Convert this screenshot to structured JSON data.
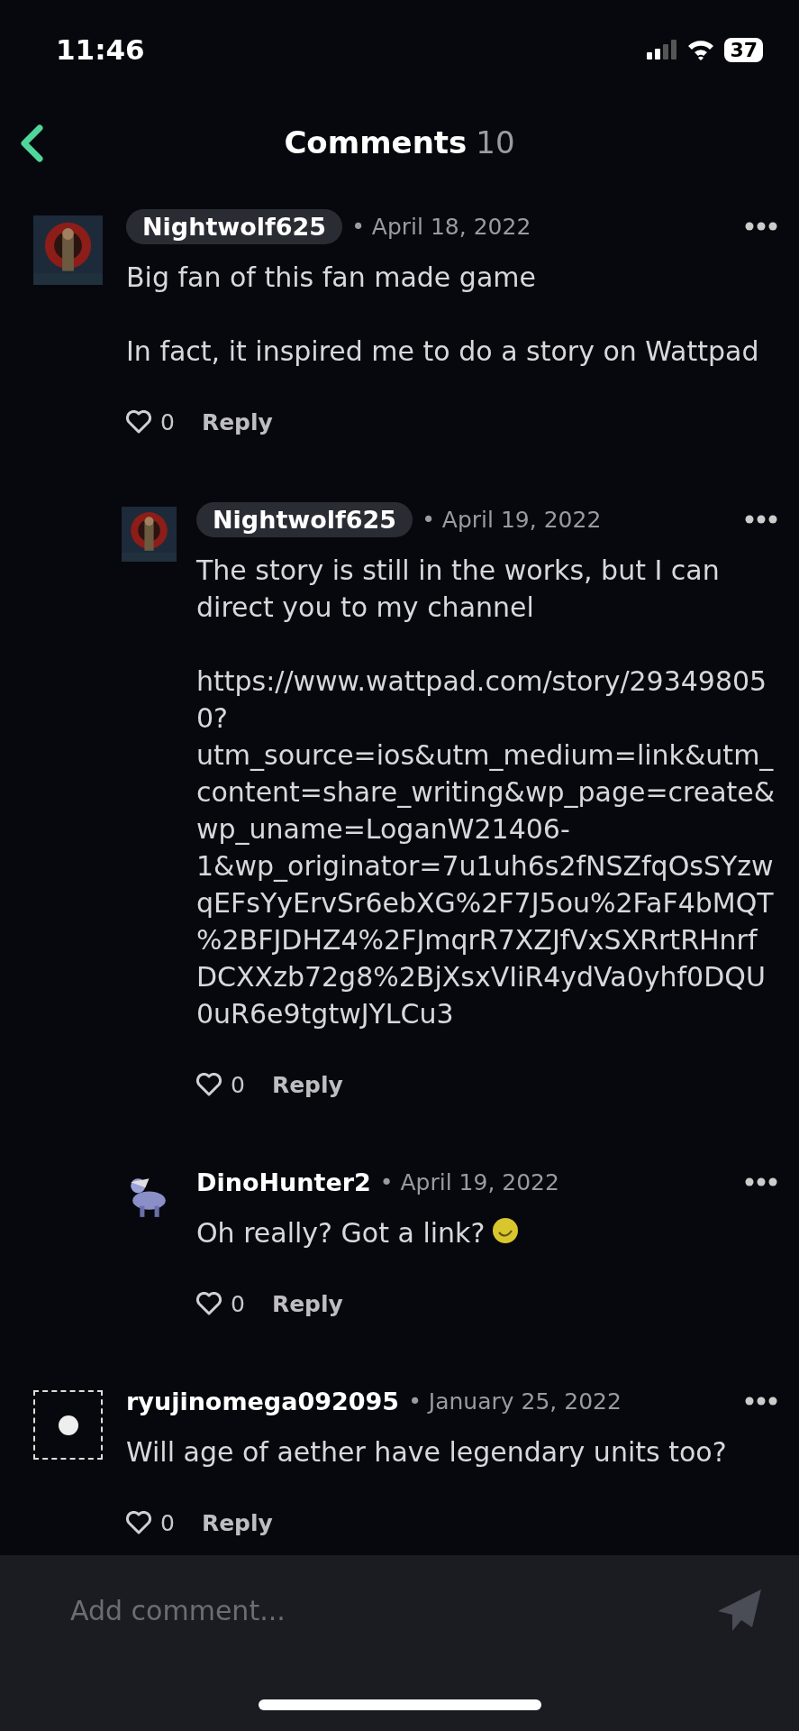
{
  "status_bar": {
    "time": "11:46",
    "battery": "37"
  },
  "header": {
    "title": "Comments",
    "count": "10"
  },
  "comments": [
    {
      "kind": "picture",
      "author": "Nightwolf625",
      "highlighted": true,
      "date": "• April 18, 2022",
      "paragraphs": [
        "Big fan of this fan made game",
        "In fact, it inspired me to do a story on Wattpad"
      ],
      "emoji": false,
      "likes": "0",
      "reply": "Reply",
      "children": [
        {
          "kind": "picture",
          "author": "Nightwolf625",
          "highlighted": true,
          "date": "• April 19, 2022",
          "paragraphs": [
            "The story is still in the works, but I can direct you to my channel",
            "https://www.wattpad.com/story/293498050?utm_source=ios&utm_medium=link&utm_content=share_writing&wp_page=create&wp_uname=LoganW21406-1&wp_originator=7u1uh6s2fNSZfqOsSYzwqEFsYyErvSr6ebXG%2F7J5ou%2FaF4bMQT%2BFJDHZ4%2FJmqrR7XZJfVxSXRrtRHnrfDCXXzb72g8%2BjXsxVIiR4ydVa0yhf0DQU0uR6e9tgtwJYLCu3"
          ],
          "emoji": false,
          "likes": "0",
          "reply": "Reply"
        },
        {
          "kind": "picture",
          "author": "DinoHunter2",
          "highlighted": false,
          "date": "• April 19, 2022",
          "paragraphs": [
            "Oh really? Got a link?"
          ],
          "emoji": true,
          "likes": "0",
          "reply": "Reply"
        }
      ]
    },
    {
      "kind": "placeholder",
      "author": "ryujinomega092095",
      "highlighted": false,
      "date": "• January 25, 2022",
      "paragraphs": [
        "Will age of aether have legendary units too?"
      ],
      "emoji": false,
      "likes": "0",
      "reply": "Reply"
    }
  ],
  "composer": {
    "placeholder": "Add comment..."
  }
}
